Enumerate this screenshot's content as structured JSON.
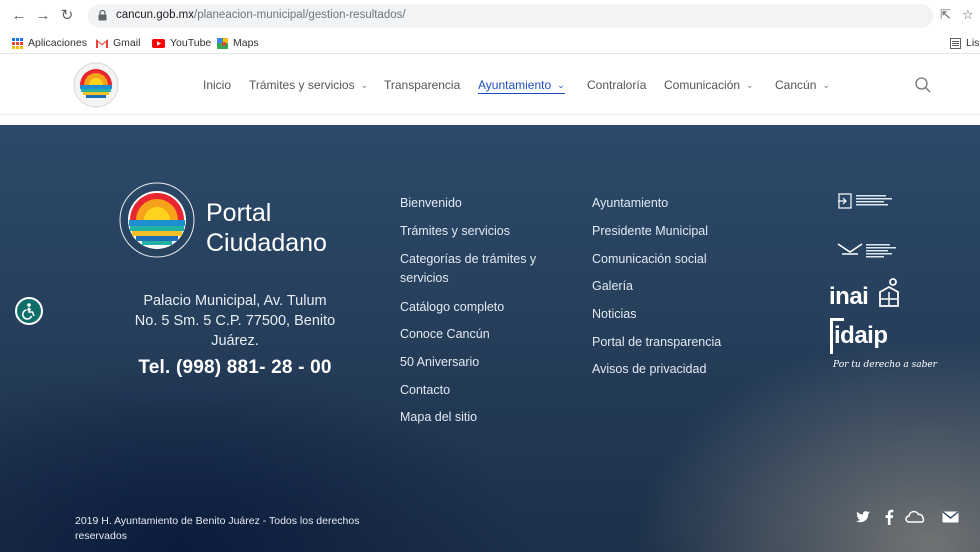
{
  "browser": {
    "url_host": "cancun.gob.mx",
    "url_path": "/planeacion-municipal/gestion-resultados/",
    "bookmarks": [
      {
        "label": "Aplicaciones",
        "icon": "apps-grid-icon"
      },
      {
        "label": "Gmail",
        "icon": "gmail-icon"
      },
      {
        "label": "YouTube",
        "icon": "youtube-icon"
      },
      {
        "label": "Maps",
        "icon": "maps-icon"
      }
    ],
    "reading_list_label": "Lis"
  },
  "header": {
    "menu": [
      {
        "label": "Inicio",
        "has_dropdown": false,
        "active": false
      },
      {
        "label": "Trámites y servicios",
        "has_dropdown": true,
        "active": false
      },
      {
        "label": "Transparencia",
        "has_dropdown": false,
        "active": false
      },
      {
        "label": "Ayuntamiento",
        "has_dropdown": true,
        "active": true
      },
      {
        "label": "Contraloría",
        "has_dropdown": false,
        "active": false
      },
      {
        "label": "Comunicación",
        "has_dropdown": true,
        "active": false
      },
      {
        "label": "Cancún",
        "has_dropdown": true,
        "active": false
      }
    ]
  },
  "footer": {
    "portal_line1": "Portal",
    "portal_line2": "Ciudadano",
    "address_line1": "Palacio Municipal, Av. Tulum",
    "address_line2": "No. 5 Sm. 5 C.P. 77500, Benito",
    "address_line3": "Juárez.",
    "phone": "Tel. (998) 881- 28 - 00",
    "col1": [
      "Bienvenido",
      "Trámites y servicios",
      "Categorías de trámites y",
      "servicios",
      "Catálogo completo",
      "Conoce Cancún",
      "50 Aniversario",
      "Contacto",
      "Mapa del sitio"
    ],
    "col2": [
      "Ayuntamiento",
      "Presidente Municipal",
      "Comunicación social",
      "Galería",
      "Noticias",
      "Portal de transparencia",
      "Avisos de privacidad"
    ],
    "inai_label": "inai",
    "idaip_label": "idaip",
    "idaip_slogan": "Por tu derecho a saber",
    "copyright_line1": "2019 H. Ayuntamiento de Benito Juárez - Todos los derechos",
    "copyright_line2": "reservados",
    "colors": {
      "accent_link": "#1f4fbf",
      "footer_bg": "#263f5c",
      "accessibility": "#0f6d6a"
    }
  }
}
